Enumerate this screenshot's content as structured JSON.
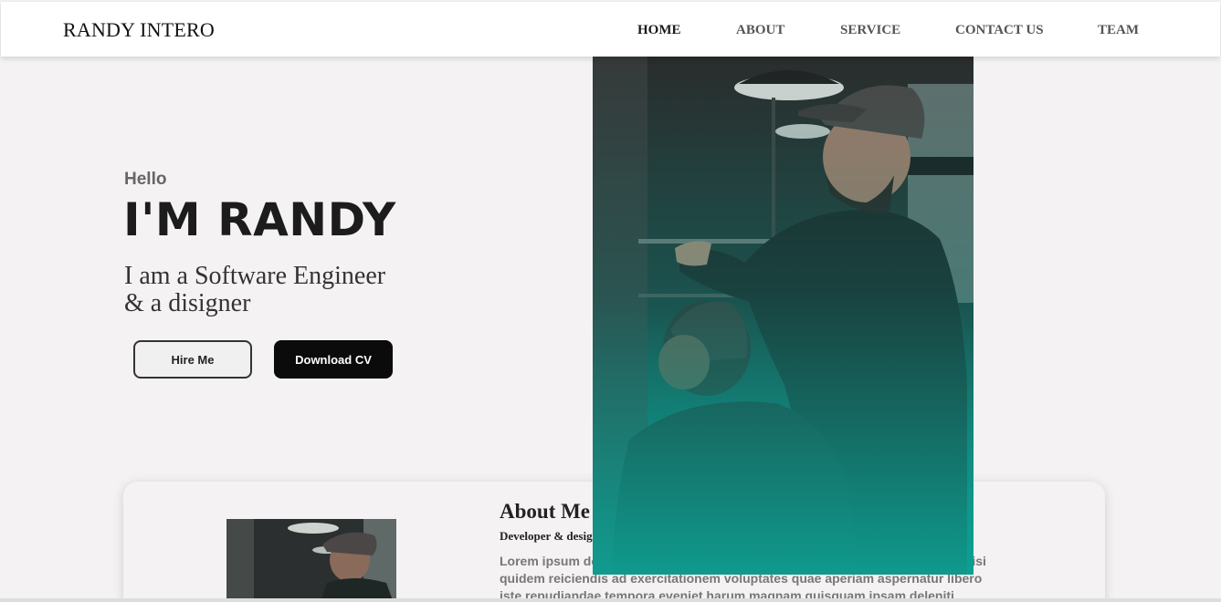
{
  "nav": {
    "brand": "RANDY INTERO",
    "items": [
      {
        "label": "HOME"
      },
      {
        "label": "ABOUT"
      },
      {
        "label": "SERVICE"
      },
      {
        "label": "CONTACT US"
      },
      {
        "label": "TEAM"
      }
    ]
  },
  "hero": {
    "greeting": "Hello",
    "headline": "I'M RANDY",
    "role_line1": "I am a Software Engineer",
    "role_line2": "& a disigner",
    "hire_button": "Hire Me",
    "cv_button": "Download CV"
  },
  "about": {
    "title": "About Me",
    "subtitle": "Developer & designer",
    "text": "Lorem ipsum dolor sit amet, consectetur adipisicing elit. Itaque perferendis, nisi quidem reiciendis ad exercitationem voluptates quae aperiam aspernatur libero iste repudiandae tempora eveniet harum magnam quisquam ipsam deleniti"
  },
  "colors": {
    "background": "#f4f2f3",
    "teal_overlay": "#0e9a8e",
    "button_dark": "#0b0b0b"
  }
}
